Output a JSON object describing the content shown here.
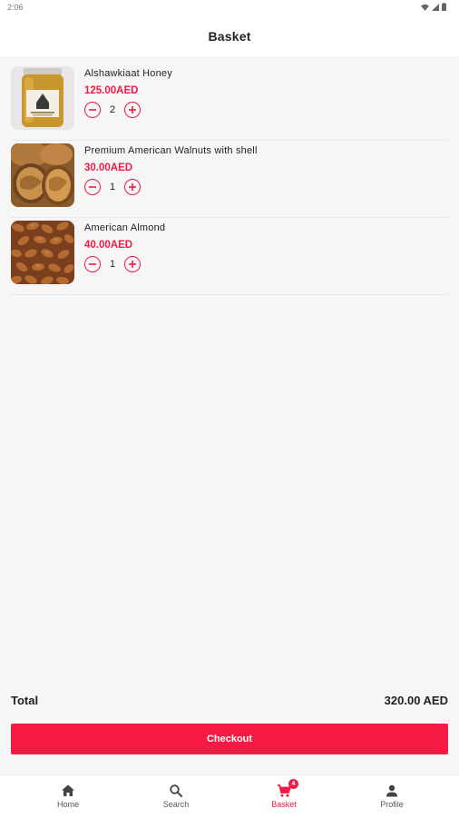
{
  "status_bar": {
    "time": "2:06"
  },
  "header": {
    "title": "Basket"
  },
  "basket": {
    "items": [
      {
        "name": "Alshawkiaat Honey",
        "price": "125.00AED",
        "quantity": "2",
        "image": "honey-jar"
      },
      {
        "name": "Premium American Walnuts with shell",
        "price": "30.00AED",
        "quantity": "1",
        "image": "walnuts"
      },
      {
        "name": "American Almond",
        "price": "40.00AED",
        "quantity": "1",
        "image": "almonds"
      }
    ]
  },
  "summary": {
    "total_label": "Total",
    "total_value": "320.00 AED"
  },
  "checkout": {
    "label": "Checkout"
  },
  "bottom_nav": {
    "items": [
      {
        "label": "Home",
        "icon": "home-icon"
      },
      {
        "label": "Search",
        "icon": "search-icon"
      },
      {
        "label": "Basket",
        "icon": "cart-icon",
        "badge": "4",
        "active": true
      },
      {
        "label": "Profile",
        "icon": "person-icon"
      }
    ]
  },
  "colors": {
    "accent": "#f71a45",
    "price": "#f11a45",
    "background": "#f6f6f6"
  }
}
